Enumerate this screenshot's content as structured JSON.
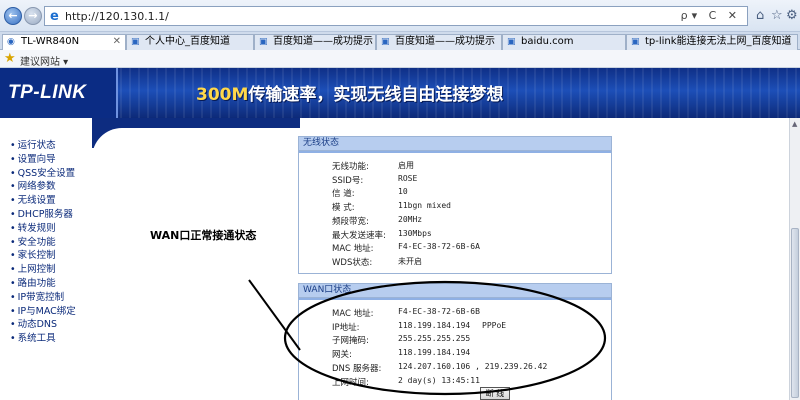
{
  "browser": {
    "url": "http://120.130.1.1/",
    "nav_back": "←",
    "nav_forward": "→",
    "addr_tools": "ρ▾ C ✕",
    "window_icons": [
      "⌂",
      "☆",
      "⚙"
    ],
    "tabs": [
      {
        "label": "TL-WR840N",
        "close": "✕",
        "active": true
      },
      {
        "label": "个人中心_百度知道",
        "close": "",
        "active": false
      },
      {
        "label": "百度知道——成功提示",
        "close": "",
        "active": false
      },
      {
        "label": "百度知道——成功提示",
        "close": "",
        "active": false
      },
      {
        "label": "baidu.com",
        "close": "",
        "active": false
      },
      {
        "label": "tp-link能连接无法上网_百度知道",
        "close": "",
        "active": false
      }
    ],
    "favorites": {
      "suggest_label": "建议网站 ▾"
    }
  },
  "banner": {
    "logo": "TP-LINK",
    "slogan_speed": "300M",
    "slogan_rest": "传输速率，实现无线自由连接梦想"
  },
  "sidebar": {
    "items": [
      "运行状态",
      "设置向导",
      "QSS安全设置",
      "网络参数",
      "无线设置",
      "DHCP服务器",
      "转发规则",
      "安全功能",
      "家长控制",
      "上网控制",
      "路由功能",
      "IP带宽控制",
      "IP与MAC绑定",
      "动态DNS",
      "系统工具"
    ]
  },
  "wireless": {
    "title": "无线状态",
    "rows": [
      {
        "label": "无线功能:",
        "value": "启用"
      },
      {
        "label": "SSID号:",
        "value": "ROSE"
      },
      {
        "label": "信 道:",
        "value": "10"
      },
      {
        "label": "模 式:",
        "value": "11bgn mixed"
      },
      {
        "label": "频段带宽:",
        "value": "20MHz"
      },
      {
        "label": "最大发送速率:",
        "value": "130Mbps"
      },
      {
        "label": "MAC 地址:",
        "value": "F4-EC-38-72-6B-6A"
      },
      {
        "label": "WDS状态:",
        "value": "未开启"
      }
    ]
  },
  "wan": {
    "title": "WAN口状态",
    "rows": [
      {
        "label": "MAC 地址:",
        "value": "F4-EC-38-72-6B-6B",
        "extra": ""
      },
      {
        "label": "IP地址:",
        "value": "118.199.184.194",
        "extra": "PPPoE"
      },
      {
        "label": "子网掩码:",
        "value": "255.255.255.255",
        "extra": ""
      },
      {
        "label": "网关:",
        "value": "118.199.184.194",
        "extra": ""
      },
      {
        "label": "DNS 服务器:",
        "value": "124.207.160.106 , 219.239.26.42",
        "extra": ""
      },
      {
        "label": "上网时间:",
        "value": "2 day(s) 13:45:11",
        "extra": ""
      }
    ],
    "disconnect_label": "断 线"
  },
  "annotation": "WAN口正常接通状态",
  "colors": {
    "banner_dark": "#0d2a78",
    "panel_header": "#b7cdef",
    "sidebar_text": "#0b2a7a",
    "slogan_speed": "#ffd84a"
  }
}
